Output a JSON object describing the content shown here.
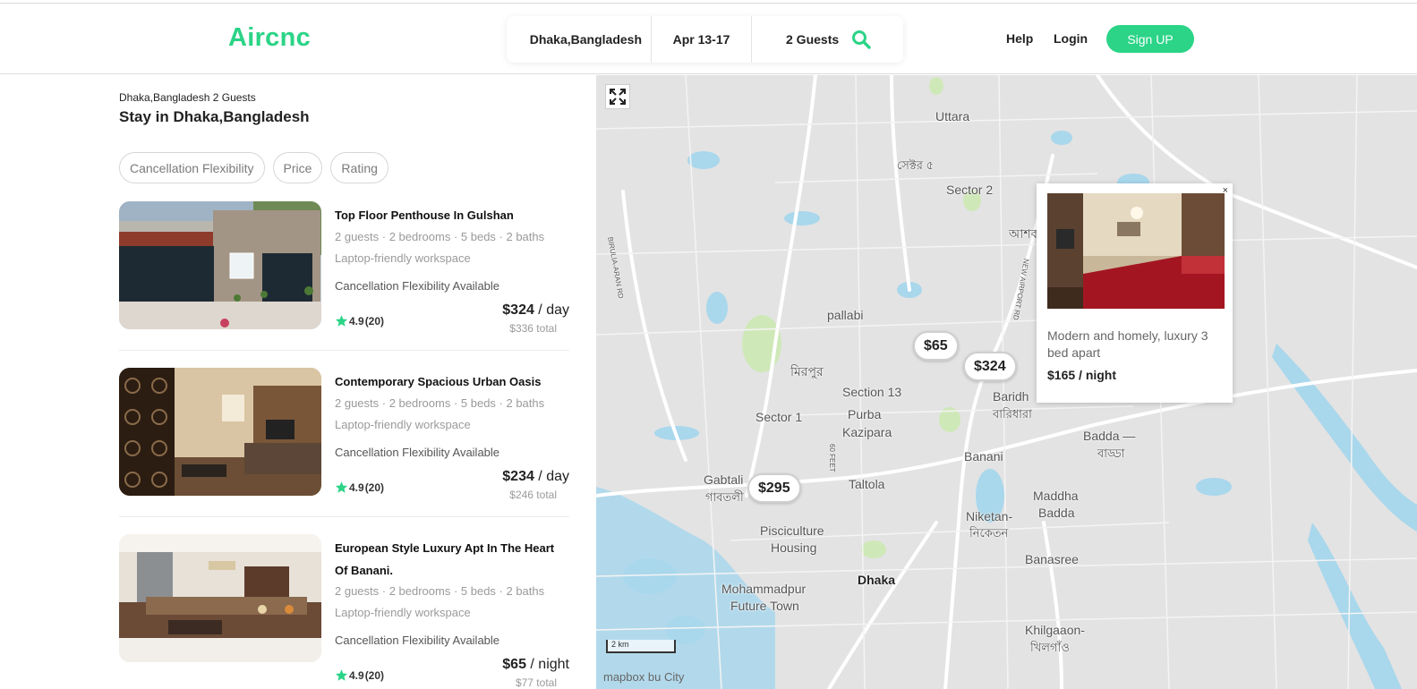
{
  "app": {
    "logo": "Aircnc"
  },
  "search": {
    "location": "Dhaka,Bangladesh",
    "dates": "Apr 13-17",
    "guests": "2 Guests"
  },
  "nav": {
    "help": "Help",
    "login": "Login",
    "signup": "Sign UP"
  },
  "results": {
    "breadcrumb": "Dhaka,Bangladesh 2 Guests",
    "title": "Stay in Dhaka,Bangladesh"
  },
  "filters": [
    "Cancellation Flexibility",
    "Price",
    "Rating"
  ],
  "listings": [
    {
      "title": "Top Floor Penthouse In Gulshan",
      "details": "2 guests · 2 bedrooms · 5 beds · 2 baths",
      "amenity": "Laptop-friendly workspace",
      "cancellation": "Cancellation Flexibility Available",
      "rating": "4.9",
      "reviews": "(20)",
      "price": "$324",
      "unit": " / day",
      "total": "$336 total"
    },
    {
      "title": "Contemporary Spacious Urban Oasis",
      "details": "2 guests · 2 bedrooms · 5 beds · 2 baths",
      "amenity": "Laptop-friendly workspace",
      "cancellation": "Cancellation Flexibility Available",
      "rating": "4.9",
      "reviews": "(20)",
      "price": "$234",
      "unit": " / day",
      "total": "$246 total"
    },
    {
      "title": "European Style Luxury Apt In The Heart Of Banani.",
      "details": "2 guests · 2 bedrooms · 5 beds · 2 baths",
      "amenity": "Laptop-friendly workspace",
      "cancellation": "Cancellation Flexibility Available",
      "rating": "4.9",
      "reviews": "(20)",
      "price": "$65",
      "unit": " / night",
      "total": "$77 total"
    }
  ],
  "map": {
    "labels": [
      "Uttara",
      "সেক্টর ৫",
      "Sector 2",
      "আশক",
      "pallabi",
      "মিরপুর",
      "Section 13",
      "Sector 1",
      "Purba",
      "Kazipara",
      "Baridh",
      "বারিধারা",
      "Badda —",
      "বাড্ডা",
      "Banani",
      "Gabtali",
      "গাবতলী",
      "Taltola",
      "Maddha",
      "Badda",
      "Niketan-",
      "নিকেতন",
      "Pisciculture",
      "Housing",
      "Banasree",
      "Dhaka",
      "Mohammadpur",
      "Future Town",
      "Khilgaaon-",
      "খিলগাঁও"
    ],
    "road_labels": [
      "BIRULIA-ARAN RD",
      "NEW AIRPORT RD",
      "60 FEET"
    ],
    "price_pins": [
      "$65",
      "$324",
      "$295"
    ],
    "scale": "2 km",
    "attribution": "mapbox",
    "attribution_tail": "bu City",
    "popup": {
      "close": "×",
      "description": "Modern and homely, luxury 3 bed apart",
      "price": "$165 / night"
    }
  },
  "colors": {
    "accent": "#2bd487",
    "map_bg": "#e3e3e3",
    "water": "#a9d7ec",
    "park": "#cfe8b8",
    "star": "#2bd487"
  },
  "icons": [
    "search-icon",
    "star-icon",
    "expand-icon",
    "close-icon"
  ]
}
